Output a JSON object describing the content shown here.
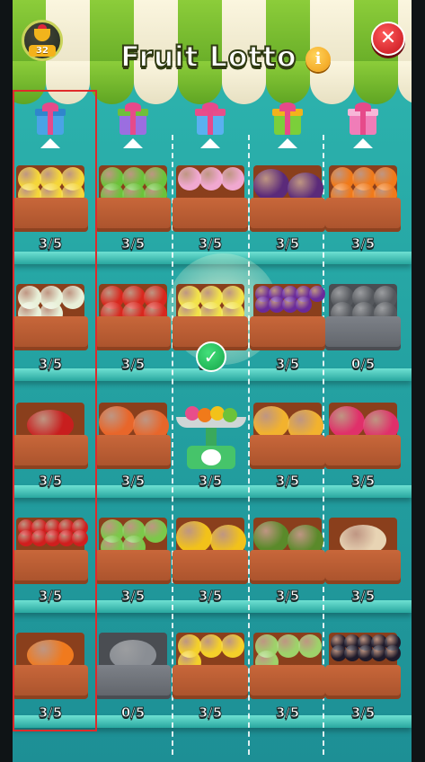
{
  "header": {
    "title": "Fruit Lotto",
    "level_badge": "32",
    "info_glyph": "i",
    "close_glyph": "✕"
  },
  "icons": {
    "trophy": "trophy-icon",
    "info": "info-icon",
    "close": "close-icon",
    "gift": "gift-icon",
    "check": "checkmark-icon",
    "scale": "scale-icon"
  },
  "colors": {
    "background": "#2fb7b0",
    "crate": "#c8673a",
    "crate_empty": "#7d8188",
    "title_text": "#ffffff",
    "close": "#d81b24",
    "info": "#f5a623",
    "check": "#22b55a",
    "selection_outline": "#e02a2a"
  },
  "gifts": [
    {
      "color": "#4aa3e6",
      "lid": "#2f86cc"
    },
    {
      "color": "#9b6ee0",
      "lid": "#6fbf3a"
    },
    {
      "color": "#5ab0f0",
      "lid": "#e84d8a"
    },
    {
      "color": "#7bcf3a",
      "lid": "#f2b21c"
    },
    {
      "color": "#f07db8",
      "lid": "#f7b7d8"
    }
  ],
  "grid": [
    [
      {
        "item": "lemon",
        "count": "3/5"
      },
      {
        "item": "green-apple",
        "count": "3/5"
      },
      {
        "item": "turnip",
        "count": "3/5"
      },
      {
        "item": "eggplant",
        "count": "3/5"
      },
      {
        "item": "orange",
        "count": "3/5"
      }
    ],
    [
      {
        "item": "cauliflower",
        "count": "3/5"
      },
      {
        "item": "tomato",
        "count": "3/5"
      },
      {
        "item": "pear",
        "count": "3/5",
        "checked": true
      },
      {
        "item": "grape",
        "count": "3/5"
      },
      {
        "item": "gray-unknown",
        "count": "0/5",
        "empty": true
      }
    ],
    [
      {
        "item": "chili-pepper",
        "count": "3/5"
      },
      {
        "item": "pumpkin",
        "count": "3/5"
      },
      {
        "item": "scale",
        "count": "3/5",
        "scale": true
      },
      {
        "item": "pineapple",
        "count": "3/5"
      },
      {
        "item": "dragon-fruit",
        "count": "3/5"
      }
    ],
    [
      {
        "item": "cherry-tomato",
        "count": "3/5"
      },
      {
        "item": "cabbage",
        "count": "3/5"
      },
      {
        "item": "corn",
        "count": "3/5"
      },
      {
        "item": "avocado",
        "count": "3/5"
      },
      {
        "item": "mushroom",
        "count": "3/5"
      }
    ],
    [
      {
        "item": "carrot",
        "count": "3/5"
      },
      {
        "item": "watermelon-slice",
        "count": "0/5",
        "empty": true
      },
      {
        "item": "banana",
        "count": "3/5"
      },
      {
        "item": "leek",
        "count": "3/5"
      },
      {
        "item": "blackberry",
        "count": "3/5"
      }
    ]
  ]
}
